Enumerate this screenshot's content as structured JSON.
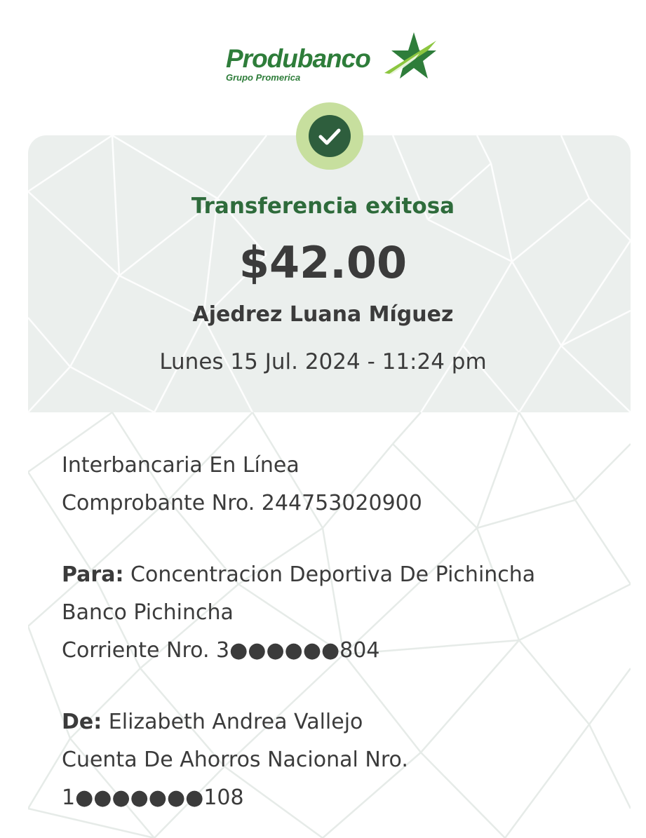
{
  "brand": {
    "name": "Produbanco",
    "subtitle": "Grupo Promerica",
    "color": "#2e7d3a"
  },
  "status": {
    "icon": "check-circle-icon",
    "label": "Transferencia exitosa",
    "color": "#2e6b3b"
  },
  "transfer": {
    "amount": "$42.00",
    "recipient_name": "Ajedrez Luana Míguez",
    "datetime": "Lunes 15 Jul. 2024 - 11:24 pm"
  },
  "details": {
    "type": "Interbancaria En Línea",
    "receipt": "Comprobante Nro. 244753020900",
    "to_label": "Para:",
    "to_name": "Concentracion Deportiva De Pichincha",
    "to_bank": "Banco Pichincha",
    "to_account": "Corriente Nro. 3●●●●●●804",
    "from_label": "De:",
    "from_name": "Elizabeth Andrea Vallejo",
    "from_account_type": "Cuenta De Ahorros Nacional Nro.",
    "from_account_number": "1●●●●●●●108"
  }
}
